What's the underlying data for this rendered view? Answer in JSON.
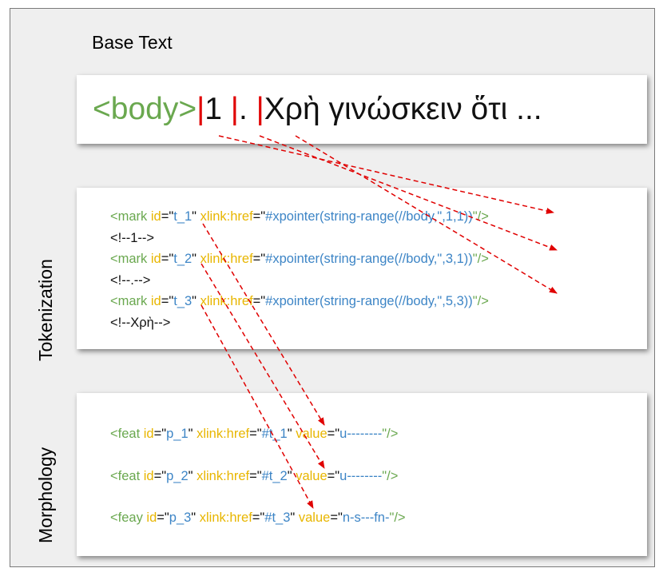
{
  "title": "Base Text",
  "base_text": {
    "tag": "<body>",
    "pipe": "|",
    "token1": "1 ",
    "token2": ". ",
    "rest": "Χρὴ γινώσκειν ὅτι ..."
  },
  "sections": {
    "tokenization": "Tokenization",
    "morphology": "Morphology"
  },
  "tokenization": {
    "lines": [
      {
        "kind": "mark",
        "open": "<mark ",
        "id_attr": "id",
        "eq1": "=\"",
        "id_val": "t_1",
        "q1": "\" ",
        "href_attr": "xlink:href",
        "eq2": "=\"",
        "href_val": "#xpointer(string-range(//body,\",1,1))",
        "close": "\"/>"
      },
      {
        "kind": "comment",
        "text": "<!--1-->"
      },
      {
        "kind": "mark",
        "open": "<mark ",
        "id_attr": "id",
        "eq1": "=\"",
        "id_val": "t_2",
        "q1": "\" ",
        "href_attr": "xlink:href",
        "eq2": "=\"",
        "href_val": "#xpointer(string-range(//body,\",3,1))",
        "close": "\"/>"
      },
      {
        "kind": "comment",
        "text": "<!--.-->"
      },
      {
        "kind": "mark",
        "open": "<mark ",
        "id_attr": "id",
        "eq1": "=\"",
        "id_val": "t_3",
        "q1": "\" ",
        "href_attr": "xlink:href",
        "eq2": "=\"",
        "href_val": "#xpointer(string-range(//body,\",5,3))",
        "close": "\"/>"
      },
      {
        "kind": "comment",
        "text": "<!--Χρὴ-->"
      }
    ]
  },
  "morphology": {
    "lines": [
      {
        "open": "<feat ",
        "id_attr": "id",
        "eq1": "=\"",
        "id_val": "p_1",
        "q1": "\" ",
        "href_attr": "xlink:href",
        "eq2": "=\"",
        "href_val": "#t_1",
        "q2": "\" ",
        "value_attr": "value",
        "eq3": "=\"",
        "value_val": "u--------",
        "close": "\"/>"
      },
      {
        "open": "<feat ",
        "id_attr": "id",
        "eq1": "=\"",
        "id_val": "p_2",
        "q1": "\" ",
        "href_attr": "xlink:href",
        "eq2": "=\"",
        "href_val": "#t_2",
        "q2": "\" ",
        "value_attr": "value",
        "eq3": "=\"",
        "value_val": "u--------",
        "close": "\"/>"
      },
      {
        "open": "<feay ",
        "id_attr": "id",
        "eq1": "=\"",
        "id_val": "p_3",
        "q1": "\" ",
        "href_attr": "xlink:href",
        "eq2": "=\"",
        "href_val": "#t_3",
        "q2": "\" ",
        "value_attr": "value",
        "eq3": "=\"",
        "value_val": "n-s---fn-",
        "close": "\"/>"
      }
    ]
  },
  "colors": {
    "tag_green": "#6aa84f",
    "attr_yellow": "#e8b600",
    "value_blue": "#3d85c6",
    "pointer_red": "#e00000"
  }
}
